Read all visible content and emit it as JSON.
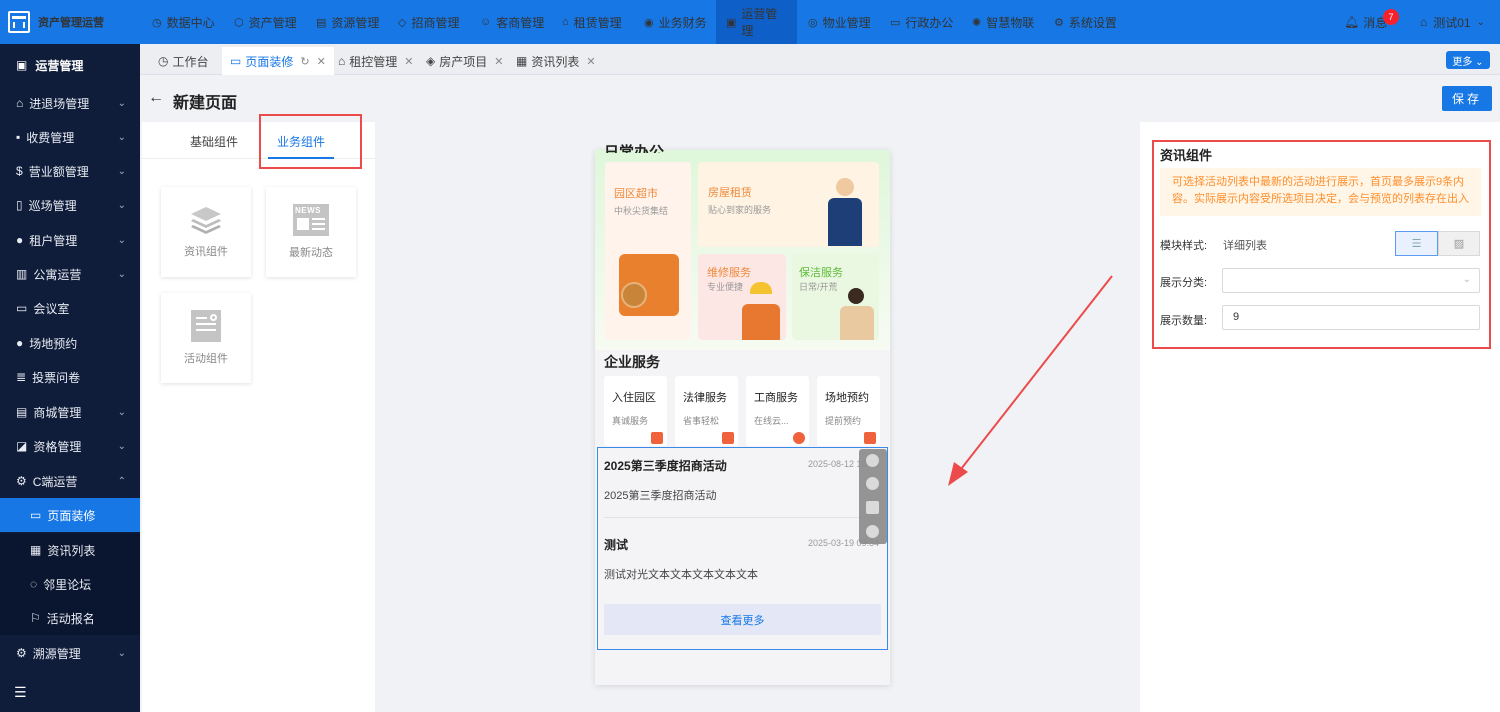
{
  "app": {
    "name": "资产管理运营"
  },
  "topnav": [
    {
      "label": "数据中心",
      "icon": "clock-icon"
    },
    {
      "label": "资产管理",
      "icon": "cube-icon"
    },
    {
      "label": "资源管理",
      "icon": "doc-icon"
    },
    {
      "label": "招商管理",
      "icon": "tag-icon"
    },
    {
      "label": "客商管理",
      "icon": "users-icon"
    },
    {
      "label": "租赁管理",
      "icon": "house-icon"
    },
    {
      "label": "业务财务",
      "icon": "coin-icon"
    },
    {
      "label": "运营管理",
      "icon": "chart-icon",
      "active": true
    },
    {
      "label": "物业管理",
      "icon": "building-icon"
    },
    {
      "label": "行政办公",
      "icon": "monitor-icon"
    },
    {
      "label": "智慧物联",
      "icon": "iot-icon"
    },
    {
      "label": "系统设置",
      "icon": "gear-icon"
    }
  ],
  "header": {
    "messages_label": "消息",
    "messages_count": "7",
    "user_name": "测试01"
  },
  "sidebar": {
    "title": "运营管理",
    "items": [
      {
        "label": "进退场管理",
        "expand": "⌄"
      },
      {
        "label": "收费管理",
        "expand": "⌄"
      },
      {
        "label": "营业额管理",
        "expand": "⌄"
      },
      {
        "label": "巡场管理",
        "expand": "⌄"
      },
      {
        "label": "租户管理",
        "expand": "⌄"
      },
      {
        "label": "公寓运营",
        "expand": "⌄"
      },
      {
        "label": "会议室",
        "expand": ""
      },
      {
        "label": "场地预约",
        "expand": ""
      },
      {
        "label": "投票问卷",
        "expand": ""
      },
      {
        "label": "商城管理",
        "expand": "⌄"
      },
      {
        "label": "资格管理",
        "expand": "⌄"
      },
      {
        "label": "C端运营",
        "expand": "⌃"
      }
    ],
    "subitems": [
      {
        "label": "页面装修",
        "active": true
      },
      {
        "label": "资讯列表"
      },
      {
        "label": "邻里论坛"
      },
      {
        "label": "活动报名"
      }
    ],
    "bottom_item": {
      "label": "溯源管理",
      "expand": "⌄"
    }
  },
  "tabs": [
    {
      "label": "工作台"
    },
    {
      "label": "页面装修",
      "active": true
    },
    {
      "label": "租控管理"
    },
    {
      "label": "房产项目"
    },
    {
      "label": "资讯列表"
    }
  ],
  "more_label": "更多 ⌄",
  "page": {
    "title": "新建页面",
    "save_label": "保存"
  },
  "component_panel": {
    "tabs": [
      "基础组件",
      "业务组件"
    ],
    "active_tab": "业务组件",
    "cards": [
      {
        "label": "资讯组件",
        "icon": "layers-icon"
      },
      {
        "label": "最新动态",
        "icon": "news-icon",
        "icon_text": "NEWS"
      },
      {
        "label": "活动组件",
        "icon": "activity-icon"
      }
    ]
  },
  "preview": {
    "section_title_partial": "日常办公",
    "tiles": [
      {
        "title": "园区超市",
        "sub": "中秋尖货集结"
      },
      {
        "title": "房屋租赁",
        "sub": "贴心到家的服务"
      },
      {
        "title": "维修服务",
        "sub": "专业便捷"
      },
      {
        "title": "保洁服务",
        "sub": "日常/开荒"
      }
    ],
    "enterprise_title": "企业服务",
    "services": [
      {
        "title": "入住园区",
        "sub": "真诚服务"
      },
      {
        "title": "法律服务",
        "sub": "省事轻松"
      },
      {
        "title": "工商服务",
        "sub": "在线云..."
      },
      {
        "title": "场地预约",
        "sub": "提前预约"
      }
    ],
    "news": [
      {
        "title": "2025第三季度招商活动",
        "date": "2025-08-12 10:33",
        "body": "2025第三季度招商活动"
      },
      {
        "title": "测试",
        "date": "2025-03-19 09:34",
        "body": "测试对光文本文本文本文本文本"
      }
    ],
    "more_label": "查看更多"
  },
  "settings": {
    "title": "资讯组件",
    "notice": "可选择活动列表中最新的活动进行展示，首页最多展示9条内容。实际展示内容受所选项目决定，会与预览的列表存在出入",
    "style_label": "模块样式:",
    "style_value": "详细列表",
    "category_label": "展示分类:",
    "category_value": "",
    "count_label": "展示数量:",
    "count_value": "9"
  },
  "colors": {
    "primary": "#1677e5",
    "sidebar": "#0f1d3a",
    "highlight": "#ec4b4b",
    "notice_text": "#ff8e2b"
  }
}
